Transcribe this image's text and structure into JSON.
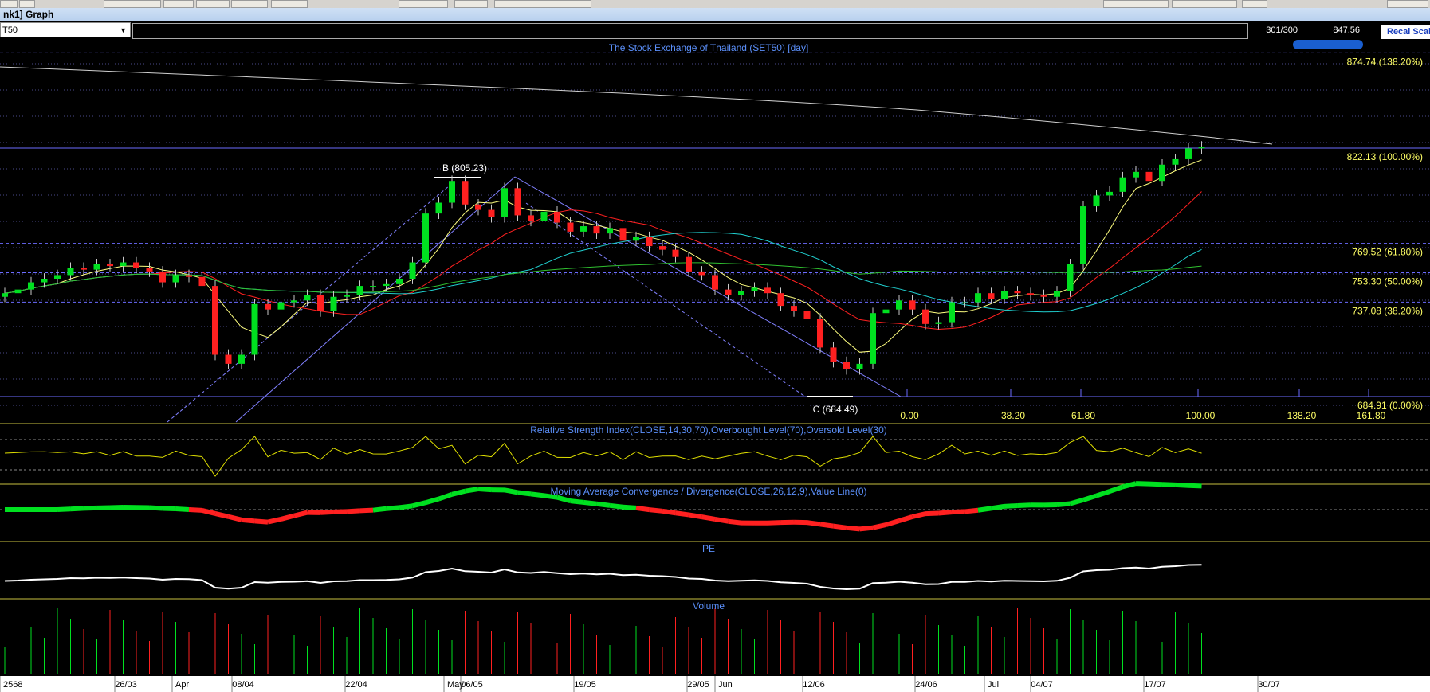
{
  "window": {
    "title": "nk1] Graph"
  },
  "symbol": "T50",
  "header": {
    "bar_count": "301/300",
    "last_price": "847.56",
    "recal_label": "Recal Scale"
  },
  "panels": {
    "price_title": "The Stock Exchange of Thailand (SET50) [day]",
    "rsi_title": "Relative Strength Index(CLOSE,14,30,70),Overbought Level(70),Oversold Level(30)",
    "macd_title": "Moving Average Convergence / Divergence(CLOSE,26,12,9),Value Line(0)",
    "pe_title": "PE",
    "volume_title": "Volume"
  },
  "colors": {
    "up": "#00e020",
    "down": "#ff2020",
    "fib_level": "#ffff66",
    "title": "#5b8ff9",
    "grid": "#6b6bff"
  },
  "chart_data": {
    "type": "candlestick",
    "title": "The Stock Exchange of Thailand (SET50) [day]",
    "fib_levels": [
      {
        "price": 874.74,
        "label": "874.74 (138.20%)"
      },
      {
        "price": 822.13,
        "label": "822.13 (100.00%)"
      },
      {
        "price": 769.52,
        "label": "769.52 (61.80%)"
      },
      {
        "price": 753.3,
        "label": "753.30 (50.00%)"
      },
      {
        "price": 737.08,
        "label": "737.08 (38.20%)"
      },
      {
        "price": 684.91,
        "label": "684.91 (0.00%)"
      }
    ],
    "annotations": [
      {
        "label": "B (805.23)",
        "price": 805.23
      },
      {
        "label": "C (684.49)",
        "price": 684.49
      }
    ],
    "time_fib_labels": [
      "0.00",
      "38.20",
      "61.80",
      "100.00",
      "138.20",
      "161.80"
    ],
    "x_tick_labels": [
      "26/03",
      "08/04",
      "22/04",
      "06/05",
      "19/05",
      "29/05",
      "12/06",
      "24/06",
      "04/07",
      "17/07",
      "30/07"
    ],
    "month_labels": [
      "2568",
      "Apr",
      "May",
      "Jun",
      "Jul"
    ],
    "closes": [
      742,
      744,
      748,
      750,
      752,
      756,
      755,
      758,
      757,
      759,
      756,
      754,
      748,
      752,
      751,
      746,
      708,
      703,
      708,
      736,
      733,
      737,
      738,
      741,
      732,
      740,
      741,
      746,
      746,
      747,
      750,
      759,
      786,
      792,
      804,
      791,
      788,
      784,
      800,
      785,
      782,
      787,
      781,
      776,
      779,
      775,
      778,
      771,
      773,
      768,
      766,
      762,
      754,
      752,
      744,
      741,
      743,
      745,
      742,
      735,
      732,
      728,
      712,
      704,
      700,
      703,
      731,
      733,
      738,
      733,
      725,
      726,
      737,
      737,
      742,
      739,
      743,
      742,
      741,
      740,
      743,
      758,
      790,
      796,
      798,
      806,
      809,
      804,
      813,
      816,
      822,
      823
    ]
  }
}
